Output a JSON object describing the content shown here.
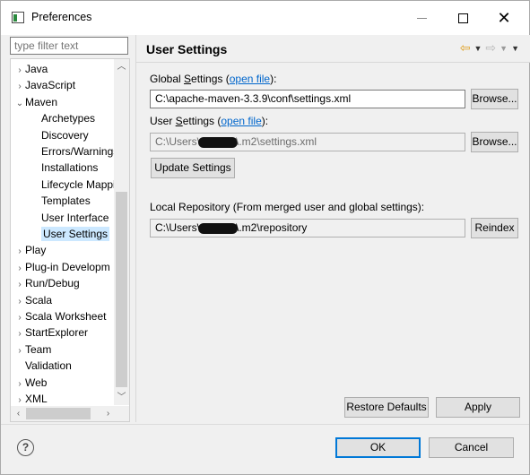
{
  "window": {
    "title": "Preferences"
  },
  "filter": {
    "placeholder": "type filter text"
  },
  "tree": {
    "items": [
      {
        "label": "Java",
        "chevron": "›",
        "indent": 0
      },
      {
        "label": "JavaScript",
        "chevron": "›",
        "indent": 0
      },
      {
        "label": "Maven",
        "chevron": "⌄",
        "indent": 0
      },
      {
        "label": "Archetypes",
        "chevron": "",
        "indent": 1
      },
      {
        "label": "Discovery",
        "chevron": "",
        "indent": 1
      },
      {
        "label": "Errors/Warnings",
        "chevron": "",
        "indent": 1
      },
      {
        "label": "Installations",
        "chevron": "",
        "indent": 1
      },
      {
        "label": "Lifecycle Mappi",
        "chevron": "",
        "indent": 1
      },
      {
        "label": "Templates",
        "chevron": "",
        "indent": 1
      },
      {
        "label": "User Interface",
        "chevron": "",
        "indent": 1
      },
      {
        "label": "User Settings",
        "chevron": "",
        "indent": 1,
        "selected": true
      },
      {
        "label": "Play",
        "chevron": "›",
        "indent": 0
      },
      {
        "label": "Plug-in Developm",
        "chevron": "›",
        "indent": 0
      },
      {
        "label": "Run/Debug",
        "chevron": "›",
        "indent": 0
      },
      {
        "label": "Scala",
        "chevron": "›",
        "indent": 0
      },
      {
        "label": "Scala Worksheet",
        "chevron": "›",
        "indent": 0
      },
      {
        "label": "StartExplorer",
        "chevron": "›",
        "indent": 0
      },
      {
        "label": "Team",
        "chevron": "›",
        "indent": 0
      },
      {
        "label": "Validation",
        "chevron": "",
        "indent": 0
      },
      {
        "label": "Web",
        "chevron": "›",
        "indent": 0
      },
      {
        "label": "XML",
        "chevron": "›",
        "indent": 0
      }
    ]
  },
  "page": {
    "title": "User Settings",
    "global_label_prefix": "Global ",
    "global_label_access": "S",
    "global_label_suffix": "ettings (",
    "global_link": "open file",
    "global_label_end": "):",
    "global_value": "C:\\apache-maven-3.3.9\\conf\\settings.xml",
    "user_label_prefix": "User ",
    "user_label_access": "S",
    "user_label_suffix": "ettings (",
    "user_link": "open file",
    "user_label_end": "):",
    "user_value_prefix": "C:\\Users\\",
    "user_value_suffix": "\\.m2\\settings.xml",
    "update_button": "Update Settings",
    "browse_button": "Browse...",
    "local_repo_label": "Local Repository (From merged user and global settings):",
    "local_repo_prefix": "C:\\Users\\",
    "local_repo_suffix": "\\.m2\\repository",
    "reindex_button": "Reindex",
    "restore_button": "Restore Defaults",
    "apply_button": "Apply"
  },
  "footer": {
    "help_glyph": "?",
    "ok_button": "OK",
    "cancel_button": "Cancel"
  },
  "colors": {
    "selection": "#cce8ff",
    "link": "#0066cc",
    "primary_border": "#0078d7"
  }
}
